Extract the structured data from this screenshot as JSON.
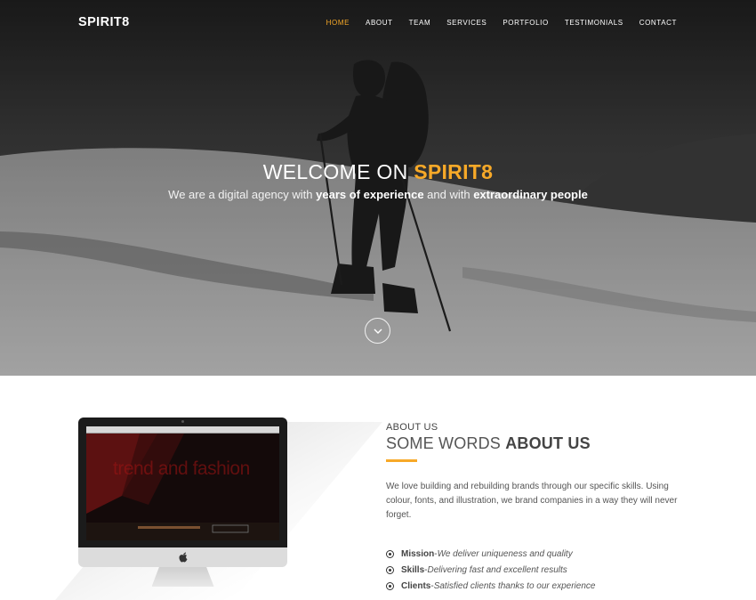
{
  "nav": {
    "logo": "SPIRIT8",
    "items": [
      {
        "label": "HOME",
        "active": true
      },
      {
        "label": "ABOUT",
        "active": false
      },
      {
        "label": "TEAM",
        "active": false
      },
      {
        "label": "SERVICES",
        "active": false
      },
      {
        "label": "PORTFOLIO",
        "active": false
      },
      {
        "label": "TESTIMONIALS",
        "active": false
      },
      {
        "label": "CONTACT",
        "active": false
      }
    ]
  },
  "hero": {
    "title_prefix": "WELCOME ON ",
    "title_accent": "SPIRIT8",
    "sub_1": "We are a digital agency with ",
    "sub_bold_1": "years of experience",
    "sub_2": " and with ",
    "sub_bold_2": "extraordinary people",
    "scroll_icon": "chevron-down-icon"
  },
  "about": {
    "eyebrow": "ABOUT US",
    "title_prefix": "SOME WORDS ",
    "title_bold": "ABOUT US",
    "paragraph": "We love building and rebuilding brands through our specific skills. Using colour, fonts, and illustration, we brand companies in a way they will never forget.",
    "features": [
      {
        "name": "Mission",
        "sep": " - ",
        "desc": "We deliver uniqueness and quality"
      },
      {
        "name": "Skills",
        "sep": " - ",
        "desc": "Delivering fast and excellent results"
      },
      {
        "name": "Clients",
        "sep": " - ",
        "desc": "Satisfied clients thanks to our experience"
      }
    ],
    "screen_text": "trend and fashion"
  },
  "colors": {
    "accent": "#f7a928",
    "text": "#444444"
  }
}
